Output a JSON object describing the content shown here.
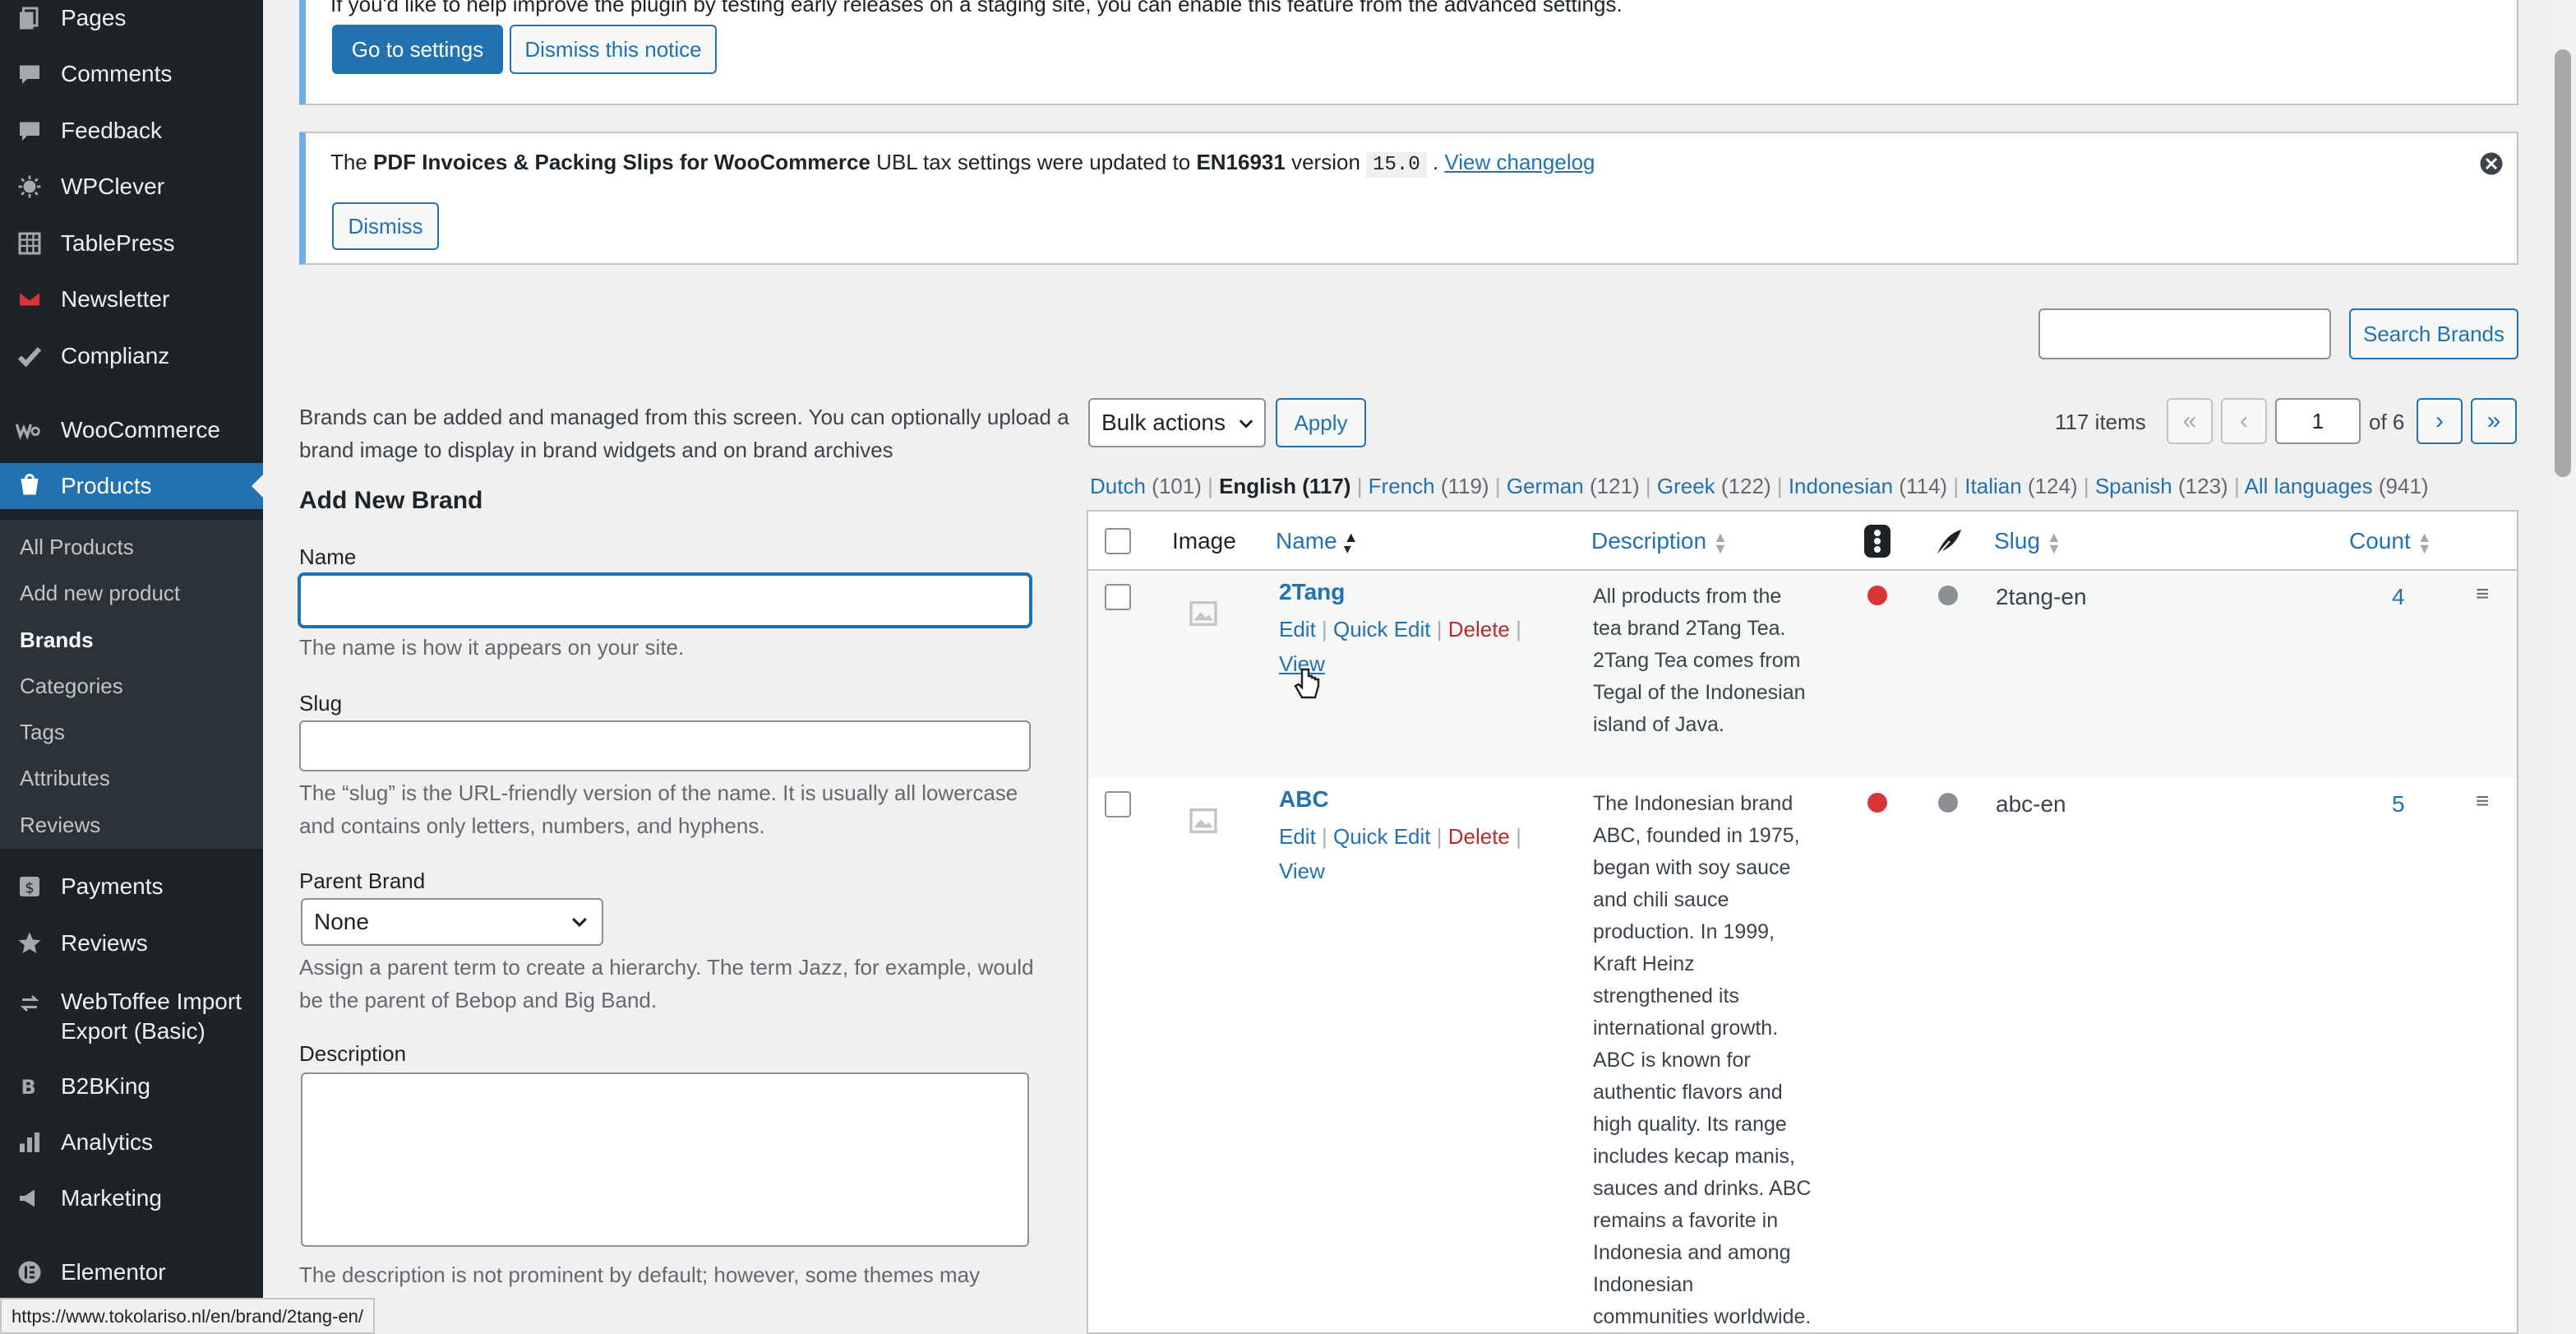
{
  "sidebar": {
    "items": [
      {
        "label": "Pages",
        "icon": "pages-icon"
      },
      {
        "label": "Comments",
        "icon": "comments-icon"
      },
      {
        "label": "Feedback",
        "icon": "feedback-icon"
      },
      {
        "label": "WPClever",
        "icon": "wpclever-icon"
      },
      {
        "label": "TablePress",
        "icon": "tablepress-icon"
      },
      {
        "label": "Newsletter",
        "icon": "newsletter-icon"
      },
      {
        "label": "Complianz",
        "icon": "check-icon"
      },
      {
        "label": "WooCommerce",
        "icon": "woocommerce-icon"
      },
      {
        "label": "Products",
        "icon": "products-icon"
      },
      {
        "label": "Payments",
        "icon": "payments-icon"
      },
      {
        "label": "Reviews",
        "icon": "star-icon"
      },
      {
        "label": "WebToffee Import",
        "label2": "Export (Basic)",
        "icon": "import-export-icon"
      },
      {
        "label": "B2BKing",
        "icon": "b2bking-icon"
      },
      {
        "label": "Analytics",
        "icon": "analytics-icon"
      },
      {
        "label": "Marketing",
        "icon": "megaphone-icon"
      },
      {
        "label": "Elementor",
        "icon": "elementor-icon"
      }
    ],
    "submenu": [
      "All Products",
      "Add new product",
      "Brands",
      "Categories",
      "Tags",
      "Attributes",
      "Reviews"
    ]
  },
  "notice1": {
    "text": "If you'd like to help improve the plugin by testing early releases on a staging site, you can enable this feature from the advanced settings.",
    "primary": "Go to settings",
    "secondary": "Dismiss this notice"
  },
  "notice2": {
    "prefix": "The ",
    "plugin": "PDF Invoices & Packing Slips for WooCommerce",
    "middle": " UBL tax settings were updated to ",
    "standard": "EN16931",
    "version_label": " version ",
    "version": "15.0",
    "dot": " . ",
    "link": "View changelog",
    "dismiss": "Dismiss"
  },
  "search": {
    "button": "Search Brands",
    "value": ""
  },
  "intro": {
    "line1": "Brands can be added and managed from this screen. You can optionally upload a",
    "line2": "brand image to display in brand widgets and on brand archives"
  },
  "form": {
    "heading": "Add New Brand",
    "name_label": "Name",
    "name_value": "",
    "name_help": "The name is how it appears on your site.",
    "slug_label": "Slug",
    "slug_value": "",
    "slug_help1": "The “slug” is the URL-friendly version of the name. It is usually all lowercase",
    "slug_help2": "and contains only letters, numbers, and hyphens.",
    "parent_label": "Parent Brand",
    "parent_value": "None",
    "parent_help1": "Assign a parent term to create a hierarchy. The term Jazz, for example, would",
    "parent_help2": "be the parent of Bebop and Big Band.",
    "desc_label": "Description",
    "desc_value": "",
    "desc_help": "The description is not prominent by default; however, some themes may"
  },
  "toolbar": {
    "bulk_actions": "Bulk actions",
    "apply": "Apply",
    "items_count": "117 items",
    "page": "1",
    "of_pages": "of 6",
    "first": "«",
    "prev": "‹",
    "next": "›",
    "last": "»"
  },
  "languages": [
    {
      "name": "Dutch",
      "count": "(101)"
    },
    {
      "name": "English",
      "count": "(117)",
      "current": true
    },
    {
      "name": "French",
      "count": "(119)"
    },
    {
      "name": "German",
      "count": "(121)"
    },
    {
      "name": "Greek",
      "count": "(122)"
    },
    {
      "name": "Indonesian",
      "count": "(114)"
    },
    {
      "name": "Italian",
      "count": "(124)"
    },
    {
      "name": "Spanish",
      "count": "(123)"
    },
    {
      "name": "All languages",
      "count": "(941)"
    }
  ],
  "table": {
    "headers": {
      "image": "Image",
      "name": "Name",
      "description": "Description",
      "slug": "Slug",
      "count": "Count"
    },
    "rows": [
      {
        "name": "2Tang",
        "actions": {
          "edit": "Edit",
          "quick_edit": "Quick Edit",
          "delete": "Delete",
          "view": "View"
        },
        "description": [
          "All products from the",
          "tea brand 2Tang Tea.",
          "2Tang Tea comes from",
          "Tegal of the Indonesian",
          "island of Java."
        ],
        "slug": "2tang-en",
        "count": "4"
      },
      {
        "name": "ABC",
        "actions": {
          "edit": "Edit",
          "quick_edit": "Quick Edit",
          "delete": "Delete",
          "view": "View"
        },
        "description": [
          "The Indonesian brand",
          "ABC, founded in 1975,",
          "began with soy sauce",
          "and chili sauce",
          "production. In 1999,",
          "Kraft Heinz",
          "strengthened its",
          "international growth.",
          "ABC is known for",
          "authentic flavors and",
          "high quality. Its range",
          "includes kecap manis,",
          "sauces and drinks. ABC",
          "remains a favorite in",
          "Indonesia and among",
          "Indonesian",
          "communities worldwide."
        ],
        "slug": "abc-en",
        "count": "5"
      }
    ]
  },
  "status_url": "https://www.tokolariso.nl/en/brand/2tang-en/",
  "colors": {
    "accent": "#2271b1",
    "sidebar": "#1d2327",
    "active": "#2271b1",
    "danger": "#b32d2e",
    "status_red": "#d63638",
    "status_grey": "#8c8f94"
  }
}
